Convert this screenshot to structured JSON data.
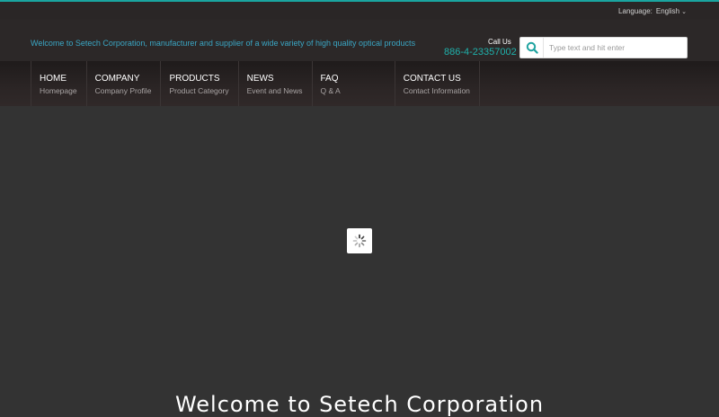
{
  "topbar": {
    "language_label": "Language:",
    "language_value": "English",
    "chevron_icon": "chevron-down-icon"
  },
  "header": {
    "marquee_text": "Welcome to Setech Corporation, manufacturer and supplier of a wide variety of high quality optical products",
    "callus_label": "Call Us",
    "phone": "886-4-23357002",
    "search": {
      "placeholder": "Type text and hit enter",
      "icon": "search-icon"
    }
  },
  "nav": {
    "items": [
      {
        "title": "HOME",
        "subtitle": "Homepage"
      },
      {
        "title": "COMPANY",
        "subtitle": "Company Profile"
      },
      {
        "title": "PRODUCTS",
        "subtitle": "Product Category"
      },
      {
        "title": "NEWS",
        "subtitle": "Event and News"
      },
      {
        "title": "FAQ",
        "subtitle": "Q & A"
      },
      {
        "title": "CONTACT US",
        "subtitle": "Contact Information"
      }
    ]
  },
  "slider": {
    "loader_icon": "spinner-icon"
  },
  "welcome": "Welcome to Setech Corporation",
  "colors": {
    "accent": "#1aa5a0",
    "background": "#333333",
    "header": "#2c2828",
    "marquee": "#3aa6c4"
  }
}
